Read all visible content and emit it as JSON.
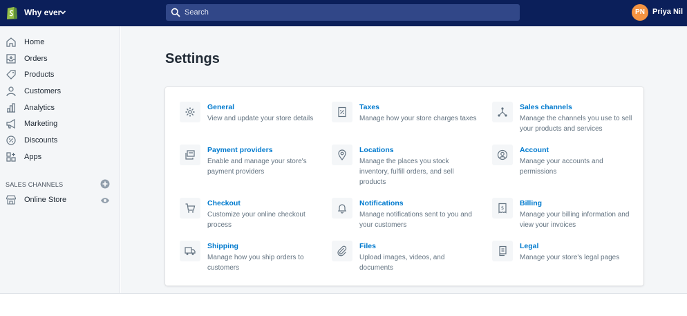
{
  "topbar": {
    "store_name": "Why ever",
    "search_placeholder": "Search",
    "user_initials": "PN",
    "user_name": "Priya Nil"
  },
  "sidebar": {
    "items": [
      {
        "label": "Home",
        "icon": "home-icon"
      },
      {
        "label": "Orders",
        "icon": "orders-icon"
      },
      {
        "label": "Products",
        "icon": "tag-icon"
      },
      {
        "label": "Customers",
        "icon": "person-icon"
      },
      {
        "label": "Analytics",
        "icon": "bar-chart-icon"
      },
      {
        "label": "Marketing",
        "icon": "megaphone-icon"
      },
      {
        "label": "Discounts",
        "icon": "discount-icon"
      },
      {
        "label": "Apps",
        "icon": "apps-icon"
      }
    ],
    "sales_channels_title": "SALES CHANNELS",
    "channels": [
      {
        "label": "Online Store",
        "icon": "store-icon"
      }
    ]
  },
  "main": {
    "title": "Settings",
    "settings": [
      {
        "title": "General",
        "desc": "View and update your store details",
        "icon": "gear-icon"
      },
      {
        "title": "Taxes",
        "desc": "Manage how your store charges taxes",
        "icon": "tax-icon"
      },
      {
        "title": "Sales channels",
        "desc": "Manage the channels you use to sell your products and services",
        "icon": "channels-icon"
      },
      {
        "title": "Payment providers",
        "desc": "Enable and manage your store's payment providers",
        "icon": "payment-icon"
      },
      {
        "title": "Locations",
        "desc": "Manage the places you stock inventory, fulfill orders, and sell products",
        "icon": "location-pin-icon"
      },
      {
        "title": "Account",
        "desc": "Manage your accounts and permissions",
        "icon": "account-icon"
      },
      {
        "title": "Checkout",
        "desc": "Customize your online checkout process",
        "icon": "cart-icon"
      },
      {
        "title": "Notifications",
        "desc": "Manage notifications sent to you and your customers",
        "icon": "bell-icon"
      },
      {
        "title": "Billing",
        "desc": "Manage your billing information and view your invoices",
        "icon": "billing-icon"
      },
      {
        "title": "Shipping",
        "desc": "Manage how you ship orders to customers",
        "icon": "truck-icon"
      },
      {
        "title": "Files",
        "desc": "Upload images, videos, and documents",
        "icon": "paperclip-icon"
      },
      {
        "title": "Legal",
        "desc": "Manage your store's legal pages",
        "icon": "legal-icon"
      }
    ]
  },
  "colors": {
    "topbar": "#0b1f5a",
    "search": "#314788",
    "link": "#007ace",
    "avatar": "#f49342"
  }
}
